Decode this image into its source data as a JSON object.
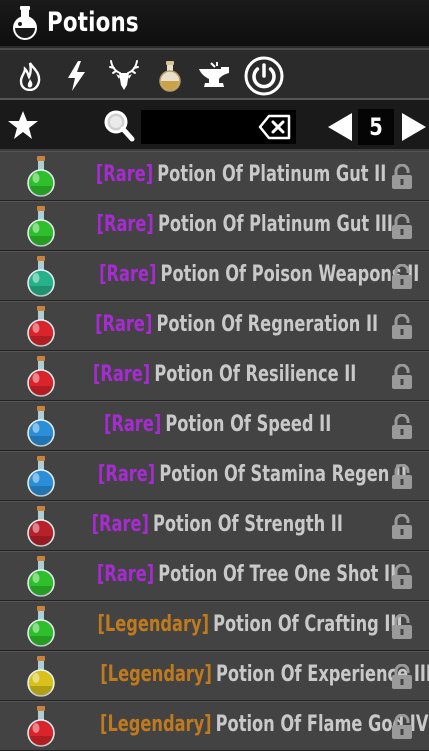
{
  "window": {
    "title": "Potions"
  },
  "categories": [
    {
      "name": "fire-icon"
    },
    {
      "name": "lightning-icon"
    },
    {
      "name": "antlers-icon"
    },
    {
      "name": "potion-flask-icon"
    },
    {
      "name": "anvil-icon"
    },
    {
      "name": "power-icon"
    }
  ],
  "search": {
    "value": "",
    "placeholder": ""
  },
  "pagination": {
    "page": "5"
  },
  "colors": {
    "rare": "#a62bd1",
    "legendary": "#c07a1e",
    "name": "#c9c9c9",
    "row": "#434343"
  },
  "items": [
    {
      "rarity": "[Rare]",
      "name": "Potion Of Platinum Gut II",
      "tier": "rare",
      "potion_color": "#2fbf2a"
    },
    {
      "rarity": "[Rare]",
      "name": "Potion Of Platinum Gut III",
      "tier": "rare",
      "potion_color": "#2fbf2a"
    },
    {
      "rarity": "[Rare]",
      "name": "Potion Of Poison Weapons II",
      "tier": "rare",
      "potion_color": "#25b28a"
    },
    {
      "rarity": "[Rare]",
      "name": "Potion Of Regneration II",
      "tier": "rare",
      "potion_color": "#d8242a"
    },
    {
      "rarity": "[Rare]",
      "name": "Potion Of Resilience II",
      "tier": "rare",
      "potion_color": "#d8242a"
    },
    {
      "rarity": "[Rare]",
      "name": "Potion Of Speed II",
      "tier": "rare",
      "potion_color": "#2a8fd8"
    },
    {
      "rarity": "[Rare]",
      "name": "Potion Of Stamina Regen II",
      "tier": "rare",
      "potion_color": "#2a8fd8"
    },
    {
      "rarity": "[Rare]",
      "name": "Potion Of Strength II",
      "tier": "rare",
      "potion_color": "#b8202a"
    },
    {
      "rarity": "[Rare]",
      "name": "Potion Of Tree One Shot II",
      "tier": "rare",
      "potion_color": "#2fbf2a"
    },
    {
      "rarity": "[Legendary]",
      "name": "Potion Of Crafting III",
      "tier": "legendary",
      "potion_color": "#2fbf2a"
    },
    {
      "rarity": "[Legendary]",
      "name": "Potion Of Experience III",
      "tier": "legendary",
      "potion_color": "#d8c21a"
    },
    {
      "rarity": "[Legendary]",
      "name": "Potion Of Flame God IV",
      "tier": "legendary",
      "potion_color": "#d8242a"
    }
  ]
}
